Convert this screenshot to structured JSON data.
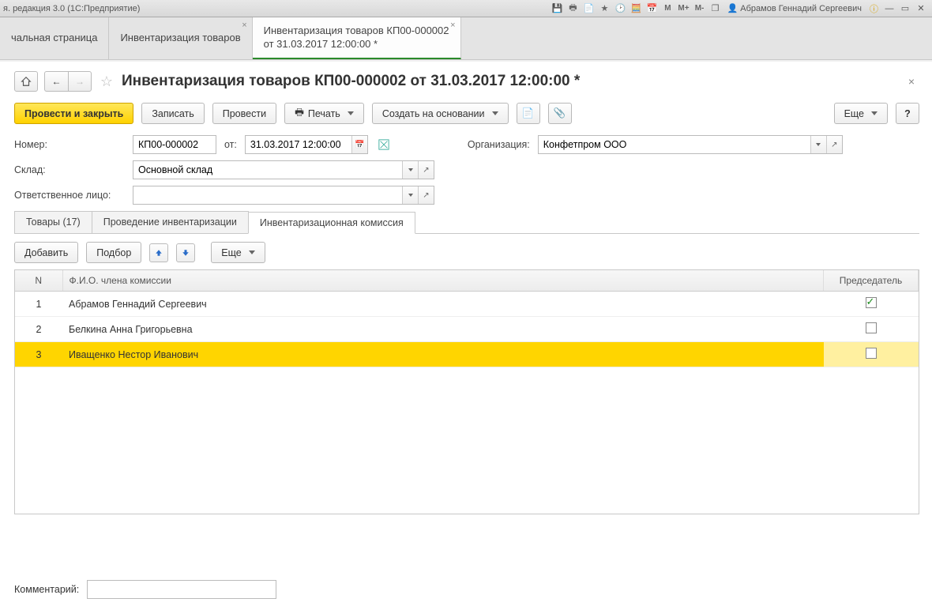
{
  "sysbar": {
    "caption": "я. редакция 3.0  (1С:Предприятие)",
    "user_name": "Абрамов Геннадий Сергеевич",
    "m_labels": [
      "M",
      "M+",
      "M-"
    ]
  },
  "apptabs": {
    "tab0": "чальная страница",
    "tab1": "Инвентаризация товаров",
    "tab2_line1": "Инвентаризация товаров КП00-000002",
    "tab2_line2": "от 31.03.2017 12:00:00 *"
  },
  "title": "Инвентаризация товаров КП00-000002 от 31.03.2017 12:00:00 *",
  "toolbar": {
    "post_close": "Провести и закрыть",
    "save": "Записать",
    "post": "Провести",
    "print": "Печать",
    "create_based": "Создать на основании",
    "more": "Еще",
    "help": "?"
  },
  "form": {
    "number_label": "Номер:",
    "number_value": "КП00-000002",
    "from_label": "от:",
    "date_value": "31.03.2017 12:00:00",
    "org_label": "Организация:",
    "org_value": "Конфетпром ООО",
    "warehouse_label": "Склад:",
    "warehouse_value": "Основной склад",
    "responsible_label": "Ответственное лицо:",
    "responsible_value": ""
  },
  "inner_tabs": {
    "tab0": "Товары (17)",
    "tab1": "Проведение инвентаризации",
    "tab2": "Инвентаризационная комиссия"
  },
  "table_toolbar": {
    "add": "Добавить",
    "select": "Подбор",
    "more": "Еще"
  },
  "table": {
    "col_n": "N",
    "col_name": "Ф.И.О. члена комиссии",
    "col_chair": "Председатель",
    "rows": [
      {
        "n": "1",
        "name": "Абрамов Геннадий Сергеевич",
        "chair": true,
        "selected": false
      },
      {
        "n": "2",
        "name": "Белкина Анна Григорьевна",
        "chair": false,
        "selected": false
      },
      {
        "n": "3",
        "name": "Иващенко Нестор Иванович",
        "chair": false,
        "selected": true
      }
    ]
  },
  "comment_label": "Комментарий:",
  "comment_value": ""
}
